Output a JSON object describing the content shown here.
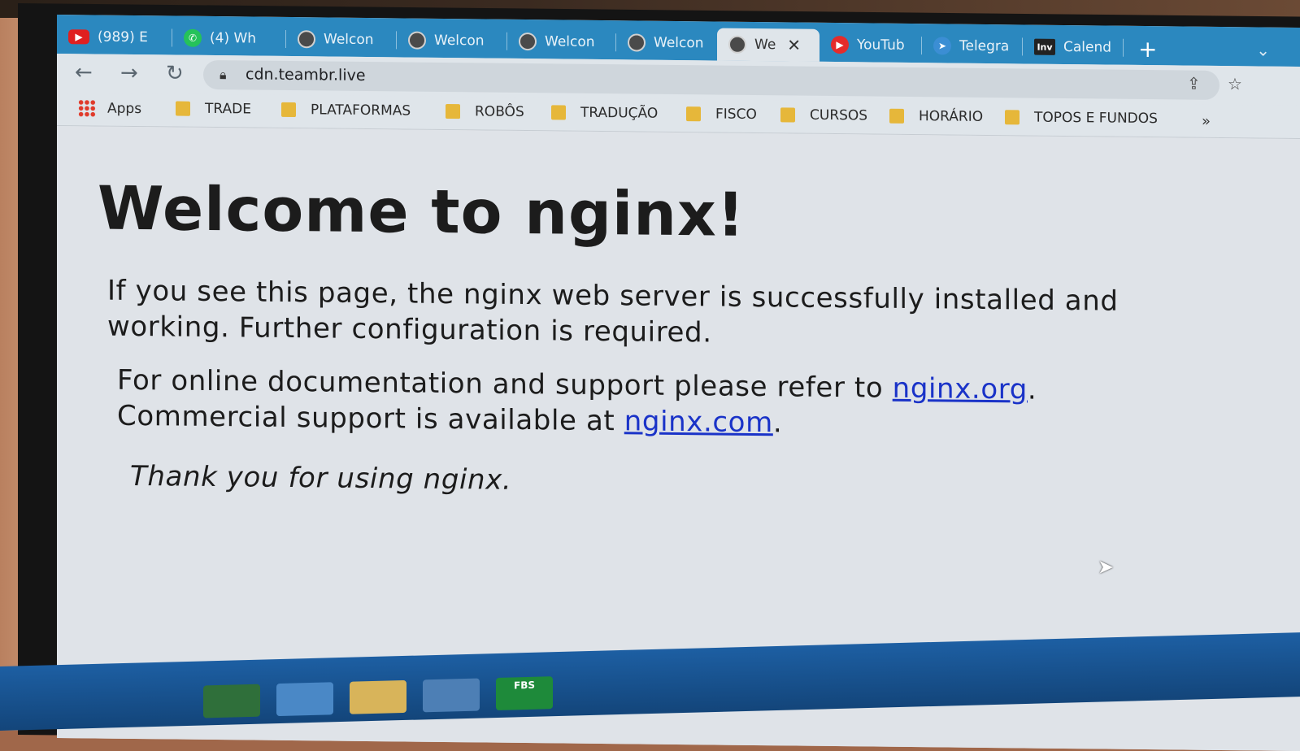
{
  "tabs": [
    {
      "label": "(989) E",
      "icon": "youtube-icon"
    },
    {
      "label": "(4) Wh",
      "icon": "whatsapp-icon"
    },
    {
      "label": "Welcon",
      "icon": "globe-icon"
    },
    {
      "label": "Welcon",
      "icon": "globe-icon"
    },
    {
      "label": "Welcon",
      "icon": "globe-icon"
    },
    {
      "label": "Welcon",
      "icon": "globe-icon"
    },
    {
      "label": "We",
      "icon": "globe-icon",
      "active": true
    },
    {
      "label": "YouTub",
      "icon": "youtube-icon"
    },
    {
      "label": "Telegra",
      "icon": "telegram-icon"
    },
    {
      "label": "Calend",
      "icon": "investing-icon"
    }
  ],
  "inv_badge": "Inv",
  "toolbar": {
    "url": "cdn.teambr.live"
  },
  "bookmarks": {
    "apps": "Apps",
    "items": [
      "TRADE",
      "PLATAFORMAS",
      "ROBÔS",
      "TRADUÇÃO",
      "FISCO",
      "CURSOS",
      "HORÁRIO",
      "TOPOS E FUNDOS"
    ],
    "more": "»"
  },
  "page": {
    "title": "Welcome to nginx!",
    "line1": "If you see this page, the nginx web server is successfully installed and",
    "line2": "working. Further configuration is required.",
    "doc_prefix": "For online documentation and support please refer to ",
    "doc_link": "nginx.org",
    "doc_suffix": ".",
    "commercial_prefix": "Commercial support is available at ",
    "commercial_link": "nginx.com",
    "commercial_suffix": ".",
    "thanks": "Thank you for using nginx."
  },
  "taskbar_label": "FBS",
  "colors": {
    "tabstrip": "#2b88bf",
    "link": "#1a33c8",
    "folder": "#e6b73a"
  }
}
